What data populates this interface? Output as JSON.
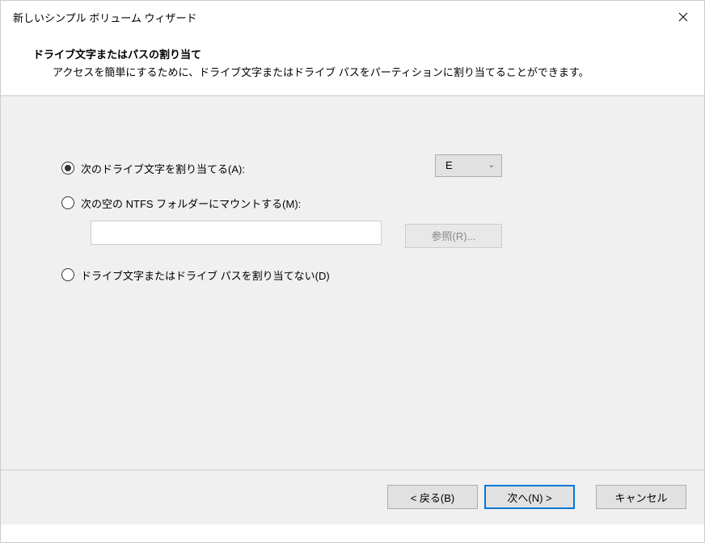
{
  "window": {
    "title": "新しいシンプル ボリューム ウィザード"
  },
  "header": {
    "title": "ドライブ文字またはパスの割り当て",
    "description": "アクセスを簡単にするために、ドライブ文字またはドライブ パスをパーティションに割り当てることができます。"
  },
  "options": {
    "assign_letter": "次のドライブ文字を割り当てる(A):",
    "mount_folder": "次の空の NTFS フォルダーにマウントする(M):",
    "no_assign": "ドライブ文字またはドライブ パスを割り当てない(D)",
    "selected_letter": "E",
    "browse_label": "参照(R)..."
  },
  "footer": {
    "back": "< 戻る(B)",
    "next": "次へ(N) >",
    "cancel": "キャンセル"
  }
}
